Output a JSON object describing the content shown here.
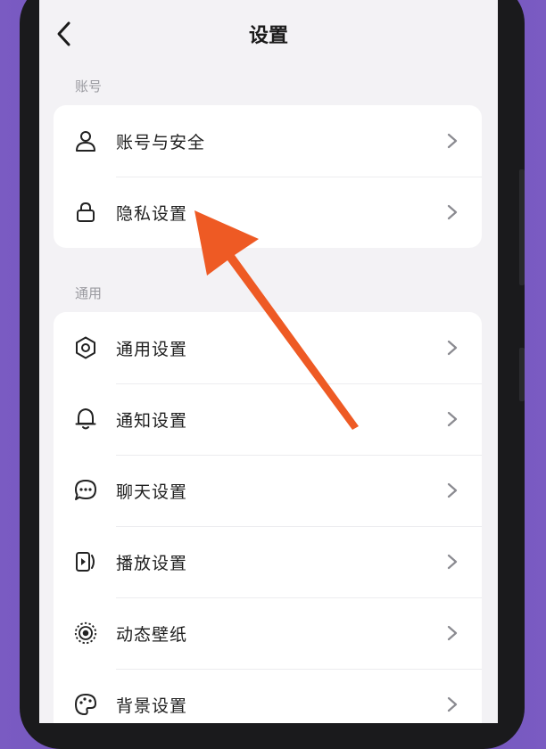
{
  "header": {
    "title": "设置"
  },
  "sections": [
    {
      "label": "账号",
      "items": [
        {
          "label": "账号与安全",
          "icon": "user-icon"
        },
        {
          "label": "隐私设置",
          "icon": "lock-icon"
        }
      ]
    },
    {
      "label": "通用",
      "items": [
        {
          "label": "通用设置",
          "icon": "gear-icon"
        },
        {
          "label": "通知设置",
          "icon": "bell-icon"
        },
        {
          "label": "聊天设置",
          "icon": "chat-bubble-icon"
        },
        {
          "label": "播放设置",
          "icon": "play-device-icon"
        },
        {
          "label": "动态壁纸",
          "icon": "live-wallpaper-icon"
        },
        {
          "label": "背景设置",
          "icon": "palette-icon"
        }
      ]
    }
  ],
  "colors": {
    "annotation_arrow": "#ee5a24",
    "card": "#ffffff",
    "background": "#f3f2f5"
  }
}
